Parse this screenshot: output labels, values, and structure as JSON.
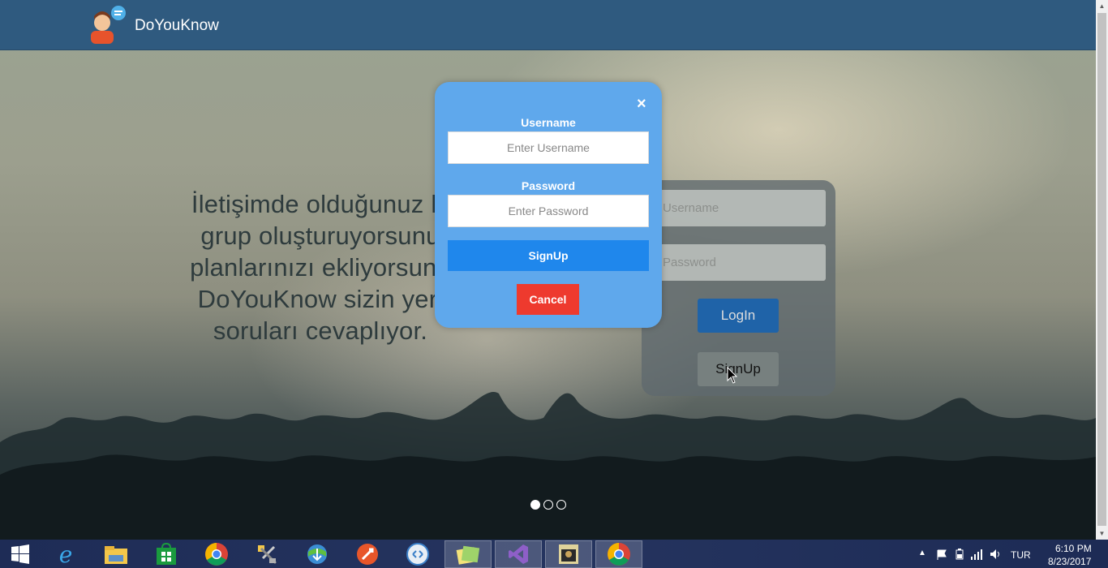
{
  "header": {
    "brand_name": "DoYouKnow",
    "logo_icon": "user-chat-logo-icon"
  },
  "hero": {
    "lines": [
      "İletişimde olduğunuz ki",
      "grup oluşturuyorsunu",
      "planlarınızı ekliyorsunu",
      "DoYouKnow sizin yeri",
      "soruları cevaplıyor."
    ]
  },
  "login_card": {
    "username_placeholder": "Username",
    "password_placeholder": "Password",
    "login_label": "LogIn",
    "signup_label": "SignUp"
  },
  "carousel": {
    "total": 3,
    "active": 1
  },
  "signup_modal": {
    "close_glyph": "×",
    "username_label": "Username",
    "username_placeholder": "Enter Username",
    "password_label": "Password",
    "password_placeholder": "Enter Password",
    "signup_label": "SignUp",
    "cancel_label": "Cancel"
  },
  "colors": {
    "header": "#2f5a7f",
    "modal": "#5fa8ec",
    "signup_button": "#1f87ec",
    "cancel_button": "#ee3a2e",
    "login_button": "#1f63a8"
  },
  "taskbar": {
    "items": [
      {
        "icon": "windows-start-icon"
      },
      {
        "icon": "internet-explorer-icon"
      },
      {
        "icon": "file-explorer-icon"
      },
      {
        "icon": "store-icon"
      },
      {
        "icon": "chrome-icon"
      },
      {
        "icon": "tools-icon"
      },
      {
        "icon": "download-manager-icon"
      },
      {
        "icon": "filezilla-icon"
      },
      {
        "icon": "remote-desktop-icon"
      },
      {
        "icon": "sticky-notes-icon"
      },
      {
        "icon": "visual-studio-icon"
      },
      {
        "icon": "game-app-icon"
      },
      {
        "icon": "chrome-icon"
      }
    ],
    "language": "TUR",
    "time": "6:10 PM",
    "date": "8/23/2017"
  }
}
